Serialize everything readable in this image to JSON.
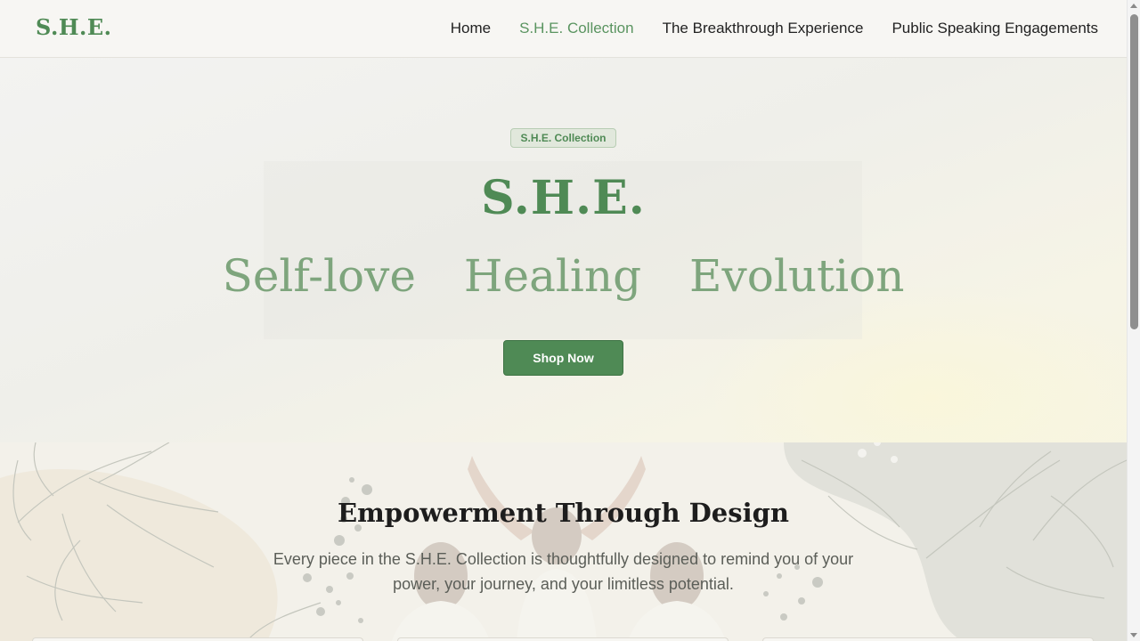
{
  "header": {
    "logo": "S.H.E.",
    "nav": [
      {
        "label": "Home",
        "active": false
      },
      {
        "label": "S.H.E. Collection",
        "active": true
      },
      {
        "label": "The Breakthrough Experience",
        "active": false
      },
      {
        "label": "Public Speaking Engagements",
        "active": false
      }
    ]
  },
  "hero": {
    "badge": "S.H.E. Collection",
    "title": "S.H.E.",
    "words": [
      "Self-love",
      "Healing",
      "Evolution"
    ],
    "cta": "Shop Now"
  },
  "section": {
    "title": "Empowerment Through Design",
    "text": "Every piece in the S.H.E. Collection is thoughtfully designed to remind you of your power, your journey, and your limitless potential."
  },
  "colors": {
    "accent": "#4f8a55",
    "accent_light": "#7ea57d",
    "background": "#f6f5f1"
  }
}
